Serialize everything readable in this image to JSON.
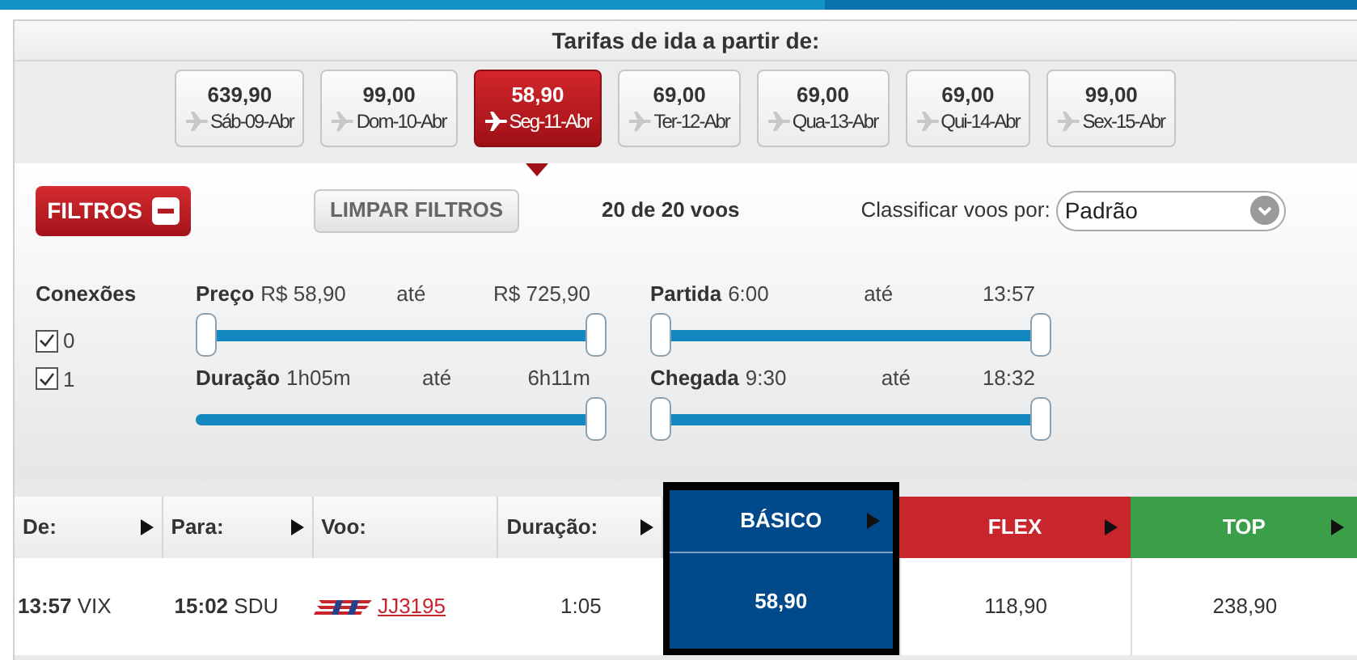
{
  "header": {
    "title": "Tarifas de ida a partir de:"
  },
  "dates": [
    {
      "price": "639,90",
      "day": "Sáb-09-Abr",
      "selected": false
    },
    {
      "price": "99,00",
      "day": "Dom-10-Abr",
      "selected": false
    },
    {
      "price": "58,90",
      "day": "Seg-11-Abr",
      "selected": true
    },
    {
      "price": "69,00",
      "day": "Ter-12-Abr",
      "selected": false
    },
    {
      "price": "69,00",
      "day": "Qua-13-Abr",
      "selected": false
    },
    {
      "price": "69,00",
      "day": "Qui-14-Abr",
      "selected": false
    },
    {
      "price": "99,00",
      "day": "Sex-15-Abr",
      "selected": false
    }
  ],
  "toolbar": {
    "filters_button": "FILTROS",
    "expanded": true,
    "clear_button": "LIMPAR FILTROS",
    "count": "20 de 20 voos",
    "sort_label": "Classificar voos por:",
    "sort_value": "Padrão"
  },
  "connections": {
    "title": "Conexões",
    "options": [
      {
        "label": "0",
        "checked": true
      },
      {
        "label": "1",
        "checked": true
      }
    ]
  },
  "sliders": [
    {
      "label": "Preço",
      "from": "R$ 58,90",
      "to_word": "até",
      "to": "R$ 725,90",
      "level": 1,
      "low_thumb": true
    },
    {
      "label": "Partida",
      "from": "6:00",
      "to_word": "até",
      "to": "13:57",
      "level": 1,
      "low_thumb": true
    },
    {
      "label": "Duração",
      "from": "1h05m",
      "to_word": "até",
      "to": "6h11m",
      "level": 1,
      "low_thumb": false
    },
    {
      "label": "Chegada",
      "from": "9:30",
      "to_word": "até",
      "to": "18:32",
      "level": 1,
      "low_thumb": true
    }
  ],
  "table": {
    "columns": [
      {
        "label": "De:"
      },
      {
        "label": "Para:"
      },
      {
        "label": "Voo:"
      },
      {
        "label": "Duração:"
      }
    ],
    "fares": [
      {
        "label": "BÁSICO",
        "color": "#004a8b",
        "selected": true
      },
      {
        "label": "FLEX",
        "color": "#c9252c",
        "selected": false
      },
      {
        "label": "TOP",
        "color": "#3a9f48",
        "selected": false
      }
    ],
    "rows": [
      {
        "from": "**13:57** VIX",
        "to": "**15:02** SDU",
        "flight": "JJ3195",
        "duration": "1:05",
        "prices": [
          "58,90",
          "118,90",
          "238,90"
        ]
      }
    ]
  }
}
